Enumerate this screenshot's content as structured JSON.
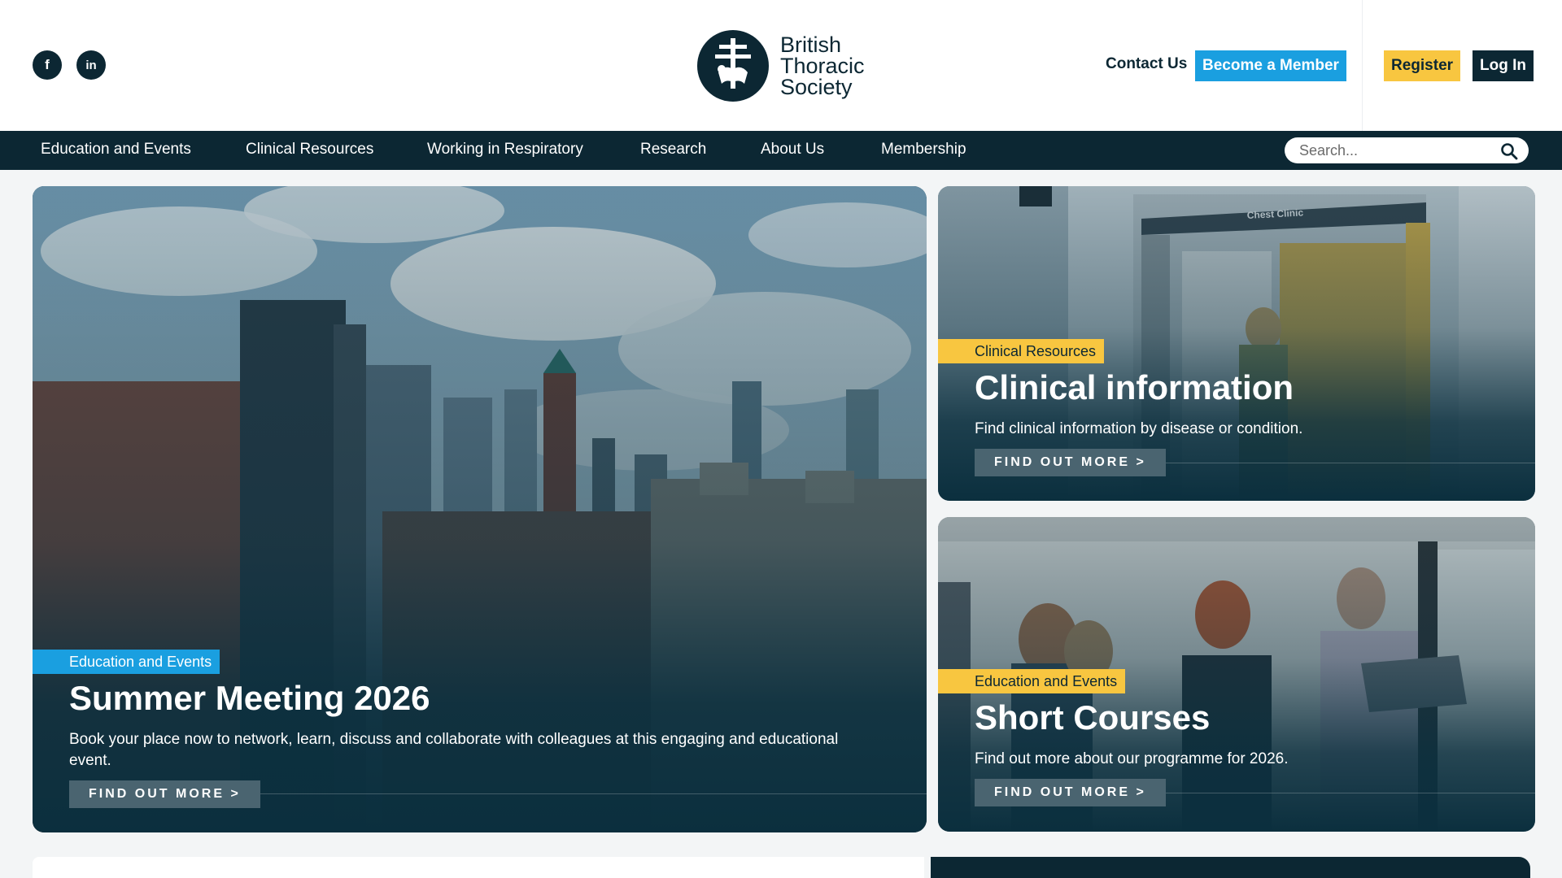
{
  "header": {
    "social": [
      {
        "name": "facebook-icon",
        "glyph": "f"
      },
      {
        "name": "linkedin-icon",
        "glyph": "in"
      }
    ],
    "logo_lines": [
      "British",
      "Thoracic",
      "Society"
    ],
    "contact_label": "Contact Us",
    "member_label": "Become a Member",
    "register_label": "Register",
    "login_label": "Log In"
  },
  "nav": {
    "items": [
      "Education and Events",
      "Clinical Resources",
      "Working in Respiratory",
      "Research",
      "About Us",
      "Membership"
    ],
    "search_placeholder": "Search..."
  },
  "cards": {
    "main": {
      "tag": "Education and Events",
      "title": "Summer Meeting 2026",
      "description": "Book your place now to network, learn, discuss and collaborate with colleagues at this engaging and educational event.",
      "cta": "FIND OUT MORE >"
    },
    "clinical": {
      "tag": "Clinical Resources",
      "title": "Clinical information",
      "description": "Find clinical information by disease or condition.",
      "cta": "FIND OUT MORE >",
      "sign_text": "Chest Clinic"
    },
    "courses": {
      "tag": "Education and Events",
      "title": "Short Courses",
      "description": "Find out more about our programme for 2026.",
      "cta": "FIND OUT MORE >"
    }
  },
  "colors": {
    "navy": "#0c2733",
    "blue": "#1a9fe0",
    "yellow": "#f8c640"
  }
}
